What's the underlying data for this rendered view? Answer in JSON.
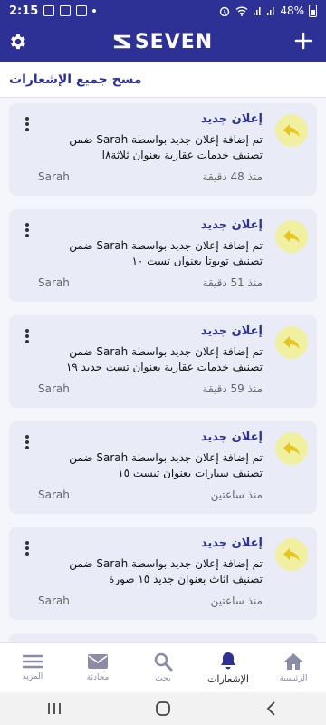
{
  "status_bar": {
    "time": "2:15",
    "battery": "48%"
  },
  "header": {
    "logo_text": "SEVEN",
    "settings_icon": "gear-icon",
    "add_icon": "plus-icon"
  },
  "page": {
    "clear_all": "مسح جميع الإشعارات"
  },
  "notifications": [
    {
      "title": "إعلان جديد",
      "body": "تم إضافة إعلان جديد بواسطة Sarah ضمن تصنيف خدمات عقارية بعنوان ثلاثة٨ا",
      "time": "منذ 48 دقيقة",
      "user": "Sarah"
    },
    {
      "title": "إعلان جديد",
      "body": "تم إضافة إعلان جديد بواسطة Sarah ضمن تصنيف تويوتا بعنوان تست ١٠",
      "time": "منذ 51 دقيقة",
      "user": "Sarah"
    },
    {
      "title": "إعلان جديد",
      "body": "تم إضافة إعلان جديد بواسطة Sarah ضمن تصنيف خدمات عقارية بعنوان تست جديد ١٩",
      "time": "منذ 59 دقيقة",
      "user": "Sarah"
    },
    {
      "title": "إعلان جديد",
      "body": "تم إضافة إعلان جديد بواسطة Sarah ضمن تصنيف سيارات بعنوان تيست ١٥",
      "time": "منذ ساعتين",
      "user": "Sarah"
    },
    {
      "title": "إعلان جديد",
      "body": "تم إضافة إعلان جديد بواسطة Sarah ضمن تصنيف اثاث بعنوان جديد ١٥ صورة",
      "time": "منذ ساعتين",
      "user": "Sarah"
    }
  ],
  "bottom_nav": [
    {
      "label": "الرئيسية",
      "icon": "home-icon",
      "active": false
    },
    {
      "label": "الإشعارات",
      "icon": "bell-icon",
      "active": true
    },
    {
      "label": "بحث",
      "icon": "search-icon",
      "active": false
    },
    {
      "label": "محادثة",
      "icon": "mail-icon",
      "active": false
    },
    {
      "label": "المزيد",
      "icon": "menu-icon",
      "active": false
    }
  ],
  "colors": {
    "brand": "#2d3196",
    "card_bg": "#e9ebf6",
    "avatar_bg": "#f1f0a0",
    "avatar_icon": "#e8c51e"
  }
}
